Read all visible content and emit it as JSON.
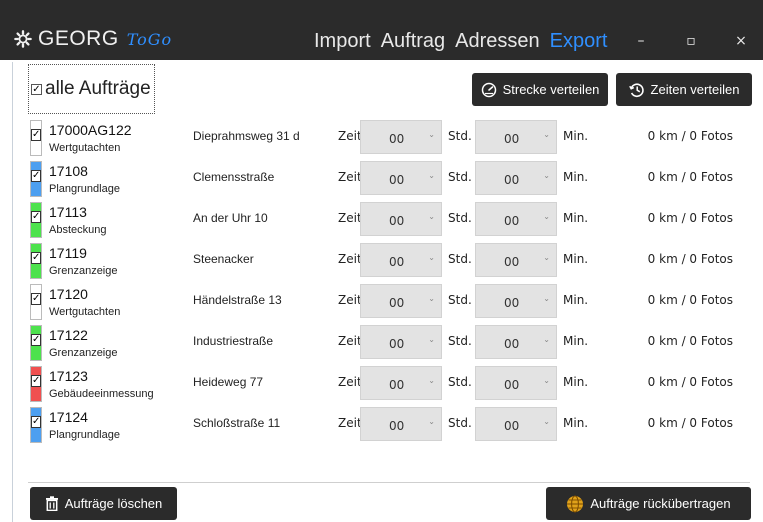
{
  "app": {
    "logo_text": "GEORG",
    "logo_suffix": "ToGo",
    "colors": {
      "titlebar": "#2b2b2b",
      "accent": "#2f8fff"
    }
  },
  "nav": {
    "items": [
      {
        "label": "Import",
        "active": false
      },
      {
        "label": "Auftrag",
        "active": false
      },
      {
        "label": "Adressen",
        "active": false
      },
      {
        "label": "Export",
        "active": true
      }
    ]
  },
  "window_controls": {
    "minimize": "–",
    "maximize": "▫",
    "close": "×"
  },
  "toolbar": {
    "select_all_label": "alle Aufträge",
    "select_all_checked": true,
    "distribute_route_label": "Strecke verteilen",
    "distribute_times_label": "Zeiten verteilen"
  },
  "labels": {
    "zeit": "Zeit",
    "std": "Std.",
    "min": "Min."
  },
  "orders": [
    {
      "number": "17000AG122",
      "type": "Wertgutachten",
      "address": "Dieprahmsweg 31 d",
      "hours": "00",
      "minutes": "00",
      "stats": "0 km / 0 Fotos",
      "color": "#ffffff",
      "checked": true
    },
    {
      "number": "17108",
      "type": "Plangrundlage",
      "address": "Clemensstraße",
      "hours": "00",
      "minutes": "00",
      "stats": "0 km / 0 Fotos",
      "color": "#4d9ff0",
      "checked": true
    },
    {
      "number": "17113",
      "type": "Absteckung",
      "address": "An der Uhr 10",
      "hours": "00",
      "minutes": "00",
      "stats": "0 km / 0 Fotos",
      "color": "#4de24d",
      "checked": true
    },
    {
      "number": "17119",
      "type": "Grenzanzeige",
      "address": "Steenacker",
      "hours": "00",
      "minutes": "00",
      "stats": "0 km / 0 Fotos",
      "color": "#4de24d",
      "checked": true
    },
    {
      "number": "17120",
      "type": "Wertgutachten",
      "address": "Händelstraße 13",
      "hours": "00",
      "minutes": "00",
      "stats": "0 km / 0 Fotos",
      "color": "#ffffff",
      "checked": true
    },
    {
      "number": "17122",
      "type": "Grenzanzeige",
      "address": "Industriestraße",
      "hours": "00",
      "minutes": "00",
      "stats": "0 km / 0 Fotos",
      "color": "#4de24d",
      "checked": true
    },
    {
      "number": "17123",
      "type": "Gebäudeeinmessung",
      "address": "Heideweg 77",
      "hours": "00",
      "minutes": "00",
      "stats": "0 km / 0 Fotos",
      "color": "#f05050",
      "checked": true
    },
    {
      "number": "17124",
      "type": "Plangrundlage",
      "address": "Schloßstraße 11",
      "hours": "00",
      "minutes": "00",
      "stats": "0 km / 0 Fotos",
      "color": "#4d9ff0",
      "checked": true
    }
  ],
  "footer": {
    "delete_label": "Aufträge löschen",
    "transfer_label": "Aufträge rückübertragen"
  },
  "icons": {
    "logo": "gear-icon",
    "route": "speedometer-icon",
    "times": "clock-history-icon",
    "delete": "trash-icon",
    "transfer": "globe-icon"
  }
}
